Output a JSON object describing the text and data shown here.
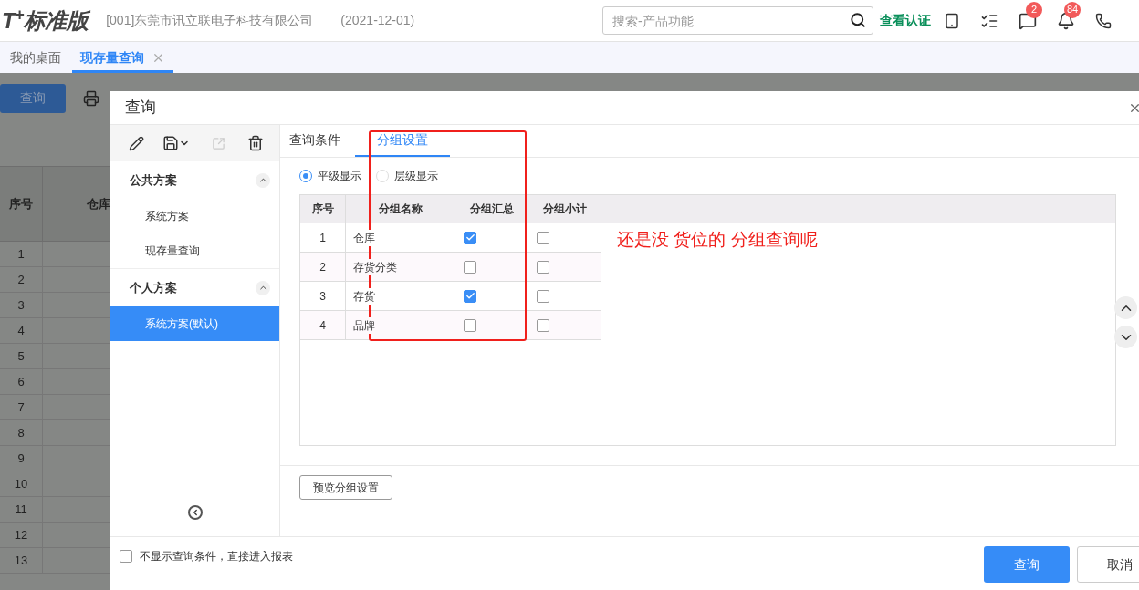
{
  "header": {
    "logo": "T$^{+}$标准版",
    "company": "[001]东莞市讯立联电子科技有限公司",
    "date": "(2021-12-01)",
    "search": {
      "placeholder": "搜索-产品功能"
    },
    "link": "查看认证",
    "badges": [
      {
        "kind": "messages",
        "count": "2"
      },
      {
        "kind": "alerts",
        "count": "84"
      }
    ]
  },
  "tabs": [
    {
      "label": "我的桌面",
      "selected": false,
      "closable": false
    },
    {
      "label": "现存量查询",
      "selected": true,
      "closable": true
    }
  ],
  "background": {
    "query_button": "查询",
    "columns": [
      "序号",
      "仓库"
    ],
    "rows": [
      "1",
      "2",
      "3",
      "4",
      "5",
      "6",
      "7",
      "8",
      "9",
      "10",
      "11",
      "12",
      "13"
    ]
  },
  "dialog": {
    "title": "查询",
    "scheme_groups": [
      {
        "title": "公共方案",
        "expanded": true,
        "items": [
          {
            "label": "系统方案",
            "selected": false
          },
          {
            "label": "现存量查询",
            "selected": false
          }
        ]
      },
      {
        "title": "个人方案",
        "expanded": true,
        "items": [
          {
            "label": "系统方案(默认)",
            "selected": true
          }
        ]
      }
    ],
    "tabs": [
      {
        "label": "查询条件",
        "selected": false
      },
      {
        "label": "分组设置",
        "selected": true
      }
    ],
    "display_modes": [
      {
        "label": "平级显示",
        "selected": true
      },
      {
        "label": "层级显示",
        "selected": false
      }
    ],
    "table": {
      "columns": [
        "序号",
        "分组名称",
        "分组汇总",
        "分组小计"
      ],
      "rows": [
        {
          "index": "1",
          "name": "仓库",
          "summary": true,
          "subtotal": false
        },
        {
          "index": "2",
          "name": "存货分类",
          "summary": false,
          "subtotal": false
        },
        {
          "index": "3",
          "name": "存货",
          "summary": true,
          "subtotal": false
        },
        {
          "index": "4",
          "name": "品牌",
          "summary": false,
          "subtotal": false
        }
      ]
    },
    "annotation": "还是没 货位的 分组查询呢",
    "preview_button": "预览分组设置",
    "skip_conditions": {
      "label": "不显示查询条件，直接进入报表",
      "checked": false
    },
    "buttons": [
      {
        "label": "查询",
        "primary": true
      },
      {
        "label": "取消",
        "primary": false
      }
    ]
  }
}
